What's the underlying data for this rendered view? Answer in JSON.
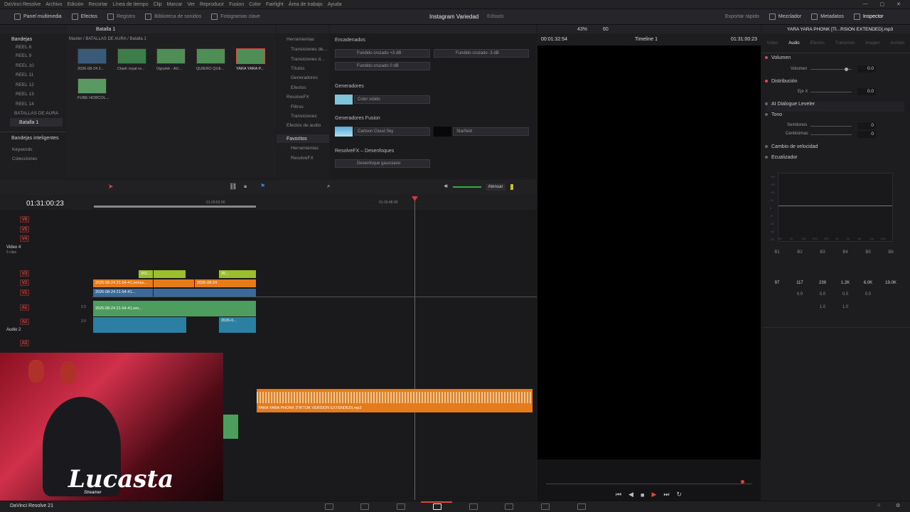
{
  "menu": [
    "DaVinci Resolve",
    "Archivo",
    "Edición",
    "Recortar",
    "Línea de tiempo",
    "Clip",
    "Marcar",
    "Ver",
    "Reproducir",
    "Fusion",
    "Color",
    "Fairlight",
    "Área de trabajo",
    "Ayuda"
  ],
  "toolbar": {
    "left": [
      "Panel multimedia",
      "Efectos",
      "Registro",
      "Biblioteca de sonidos",
      "Fotogramas clave"
    ],
    "project_title": "Instagram Variedad",
    "project_status": "Editado",
    "right": [
      "Exportar rápido",
      "Mezclador",
      "Metadatos",
      "Inspector"
    ]
  },
  "bins": {
    "header": "Bandejas",
    "items": [
      "REEL 8",
      "REEL 9",
      "REEL 10",
      "REEL 11",
      "REEL 12",
      "REEL 13",
      "REEL 14",
      "BATALLAS DE AURA",
      "Batalla 1"
    ],
    "smart_header": "Bandejas inteligentes",
    "smart_items": [
      "Keywords",
      "Colecciones"
    ]
  },
  "media_pool": {
    "bin_name": "Batalla 1",
    "breadcrumb": "Master / BATALLAS DE AURA / Batalla 1",
    "clips": [
      "2026-08-24 2...",
      "Clash royal re...",
      "Ogrytek - AU...",
      "QUIERO QUE...",
      "YARA YARA P...",
      "FUBE HORCOL..."
    ]
  },
  "effects_tree": [
    "Herramientas",
    "Transiciones de...",
    "Transiciones d...",
    "Títulos",
    "Generadores",
    "Efectos",
    "ResolveFX",
    "Filtros",
    "Transiciones",
    "Efectos de audio",
    "Favoritos",
    "Herramientas",
    "ResolveFX"
  ],
  "effects": {
    "sec1": "Encadenados",
    "sec1_items": [
      "Fundido cruzado +3 dB",
      "Fundido cruzado -3 dB",
      "Fundido cruzado 0 dB"
    ],
    "sec2": "Generadores",
    "sec2_items": [
      "Color sólido"
    ],
    "sec3": "Generadores Fusion",
    "sec3_items": [
      "Cartoon Cloud Sky",
      "Starfield"
    ],
    "sec4": "ResolveFX – Desenfoques",
    "sec4_items": [
      "Desenfoque gaussiano"
    ]
  },
  "viewer": {
    "zoom": "43%",
    "fps": "60",
    "source_tc": "00:01:32:54",
    "timeline_name": "Timeline 1",
    "record_tc": "01:31:00:23"
  },
  "timeline": {
    "timecode": "01:31:00:23",
    "ruler_marks": [
      "01:29:52:00",
      "01:30:48:00"
    ],
    "audio_mode": "Atenuar",
    "tracks": [
      "V6",
      "V5",
      "V4",
      "Video 4",
      "6 clips",
      "V3",
      "V2",
      "V1",
      "A1",
      "A2",
      "Audio 2",
      "A3"
    ],
    "track_gain": [
      "2.0",
      "2.0"
    ],
    "clip_labels": [
      "2026-08-24 21-54-41.remux...",
      "2026-08-24 21-54-41...",
      "2026-08-24 21-54-41.ren...",
      "2026-08-24",
      "2026-0...",
      "202...",
      "20..."
    ],
    "music_clip": "YARA YARA PHONK [TIKTOK VERSION EXTENDED].mp3"
  },
  "inspector": {
    "file": "YARA YARA PHONK [TI...RSION EXTENDED].mp3",
    "tabs": [
      "Vídeo",
      "Audio",
      "Efectos",
      "Transición",
      "Imagen",
      "Archivo"
    ],
    "active_tab": "Audio",
    "volume_section": "Volumen",
    "volume_label": "Volumen",
    "volume_value": "0.0",
    "dist_section": "Distribución",
    "dist_label": "Eje X",
    "dist_value": "0.0",
    "dialogue": "AI Dialogue Leveler",
    "tone": "Tono",
    "semitones_label": "Semitonos",
    "semitones_value": "0",
    "cents_label": "Centésimas",
    "cents_value": "0",
    "speed": "Cambio de velocidad",
    "eq": "Ecualizador",
    "eq_db_labels": [
      "+20",
      "+15",
      "+10",
      "+5",
      "0",
      "-5",
      "-10",
      "-15",
      "-20"
    ],
    "eq_freq_labels": [
      "30",
      "50",
      "100",
      "200",
      "500",
      "1k",
      "2k",
      "5k",
      "10k",
      "20k"
    ],
    "eq_bands": [
      "B1",
      "B2",
      "B3",
      "B4",
      "B5",
      "B6"
    ],
    "eq_freqs": [
      "97",
      "117",
      "239",
      "1.2K",
      "6.0K",
      "19.0K"
    ],
    "eq_gains": [
      "0.0",
      "0.0",
      "0.0",
      "0.0"
    ],
    "eq_q": [
      "1.0",
      "1.0"
    ]
  },
  "overlay": {
    "streamer_name": "Lucasta",
    "streamer_tag": "Streamer"
  },
  "bottom": {
    "app": "DaVinci Resolve 21"
  },
  "colors": {
    "accent": "#e0473c",
    "orange": "#e57b1b",
    "green": "#4c9d5e",
    "lime": "#9bbf2c",
    "teal": "#2a7fa3"
  }
}
